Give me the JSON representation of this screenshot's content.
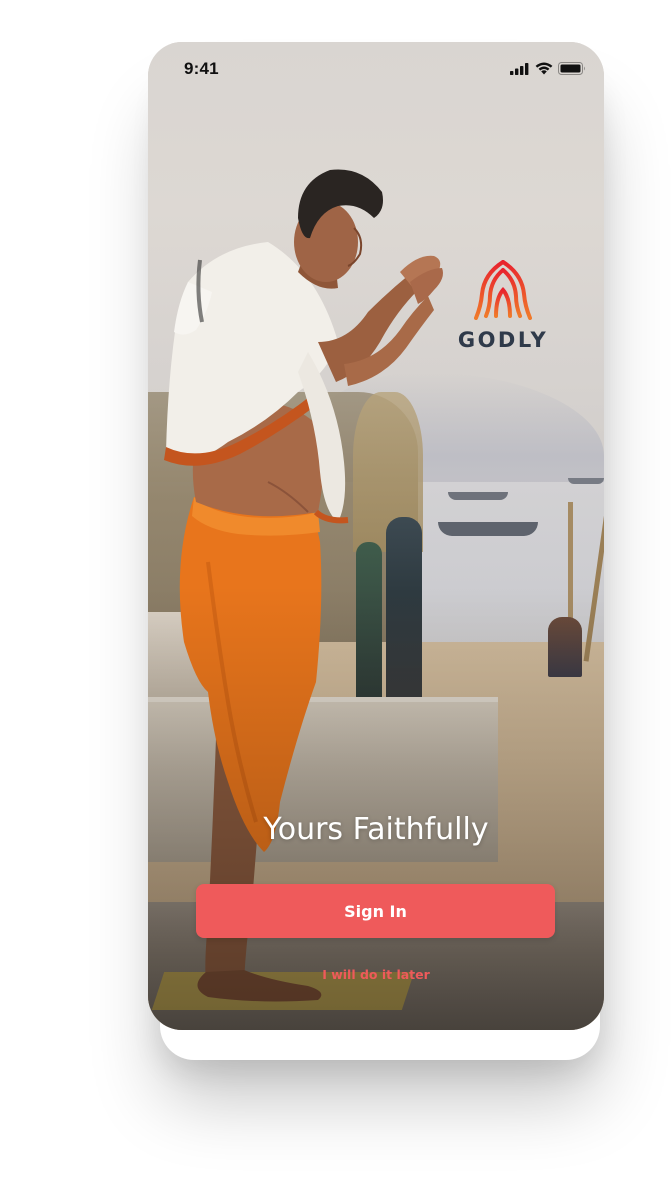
{
  "status_bar": {
    "time": "9:41",
    "icons": [
      "signal-icon",
      "wifi-icon",
      "battery-icon"
    ]
  },
  "brand": {
    "name": "GODLY",
    "mark_icon": "praying-hands-logo-icon",
    "colors": {
      "logo_gradient_top": "#e8232e",
      "logo_gradient_bottom": "#f07a2a",
      "wordmark": "#2f3a4a"
    }
  },
  "hero": {
    "tagline": "Yours Faithfully"
  },
  "actions": {
    "sign_in_label": "Sign In",
    "later_label": "I will do it later",
    "accent_color": "#ef5a5b"
  }
}
